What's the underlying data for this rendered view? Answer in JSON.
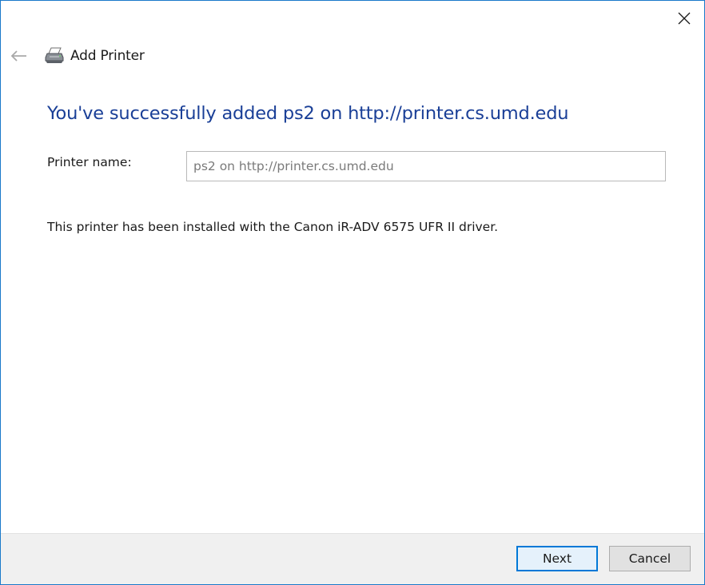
{
  "window": {
    "title": "Add Printer",
    "icons": {
      "close": "close-icon",
      "back": "back-arrow-icon",
      "printer": "printer-icon"
    },
    "colors": {
      "accent": "#1a3f97",
      "border": "#1979ca",
      "primary_button": "#0078d7"
    }
  },
  "content": {
    "heading": "You've successfully added ps2 on http://printer.cs.umd.edu",
    "printer_name_label": "Printer name:",
    "printer_name_value": "ps2 on http://printer.cs.umd.edu",
    "driver_message": "This printer has been installed with the Canon iR-ADV 6575 UFR II driver."
  },
  "footer": {
    "next_label": "Next",
    "cancel_label": "Cancel"
  }
}
